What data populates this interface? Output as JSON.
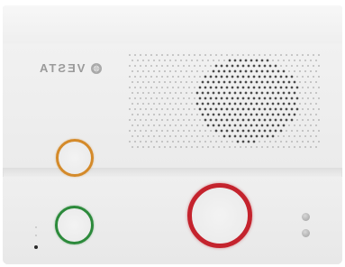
{
  "brand": {
    "logo_text": "VESTA",
    "logo_icon": "vesta-logo-icon"
  },
  "device": {
    "buttons": [
      {
        "name": "orange-ring-button",
        "color": "#d48a2a"
      },
      {
        "name": "green-ring-button",
        "color": "#2c8a3b"
      },
      {
        "name": "red-ring-button",
        "color": "#c4232d"
      }
    ],
    "indicator_leds": 2,
    "body_color": "#efefef"
  }
}
